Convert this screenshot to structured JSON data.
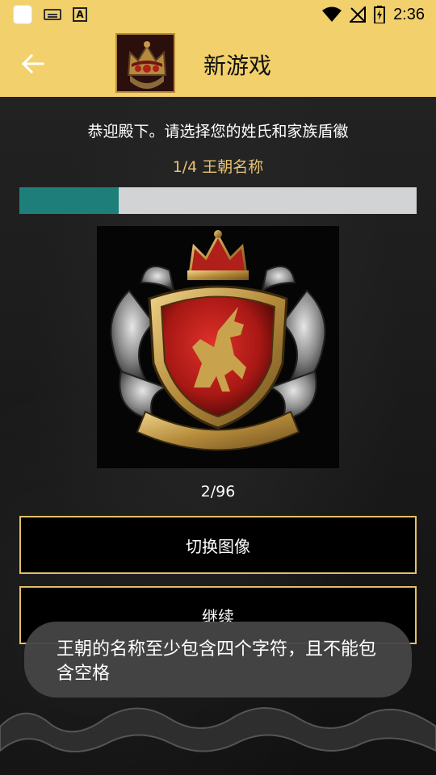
{
  "status_bar": {
    "time": "2:36",
    "icons": [
      "app-icon",
      "keyboard-icon",
      "font-a-icon",
      "wifi-icon",
      "no-signal-icon",
      "battery-charging-icon"
    ]
  },
  "app_bar": {
    "title": "新游戏",
    "back_icon": "arrow-left-icon",
    "avatar_icon": "crown-avatar"
  },
  "main": {
    "greeting": "恭迎殿下。请选择您的姓氏和家族盾徽",
    "step_label": "1/4 王朝名称",
    "progress": 0.25,
    "crest_image": "red-shield-unicorn-crest",
    "crest_counter": "2/96",
    "switch_button": "切换图像",
    "continue_button": "继续"
  },
  "toast": {
    "message": "王朝的名称至少包含四个字符，且不能包含空格"
  },
  "colors": {
    "accent_yellow": "#f2d06b",
    "gold_text": "#e8c271",
    "button_border": "#e3bf6a",
    "progress_track": "#d1d3d4",
    "progress_fill": "#1e7f7a"
  }
}
